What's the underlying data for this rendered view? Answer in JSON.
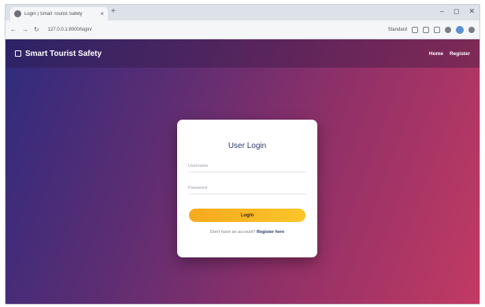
{
  "browser": {
    "tab_title": "Login | Smart Tourist Safety",
    "new_tab_symbol": "+",
    "close_symbol": "×",
    "url": "127.0.0.1:8000/login/",
    "zoom_label": "Standard",
    "window_controls": [
      "–",
      "◻",
      "✕"
    ],
    "nav": {
      "back": "←",
      "forward": "→",
      "reload": "↻"
    }
  },
  "navbar": {
    "brand_name": "Smart Tourist Safety",
    "links": [
      {
        "label": "Home"
      },
      {
        "label": "Register"
      }
    ]
  },
  "login_card": {
    "title": "User Login",
    "username_placeholder": "Username",
    "password_placeholder": "Password",
    "login_label": "Login",
    "register_prompt": "Don't have an account?",
    "register_link": "Register here"
  },
  "colors": {
    "gradient_start": "#2f2c7e",
    "gradient_end": "#c23a63",
    "button_accent": "#fbc62a",
    "title_color": "#2d3a6a"
  }
}
